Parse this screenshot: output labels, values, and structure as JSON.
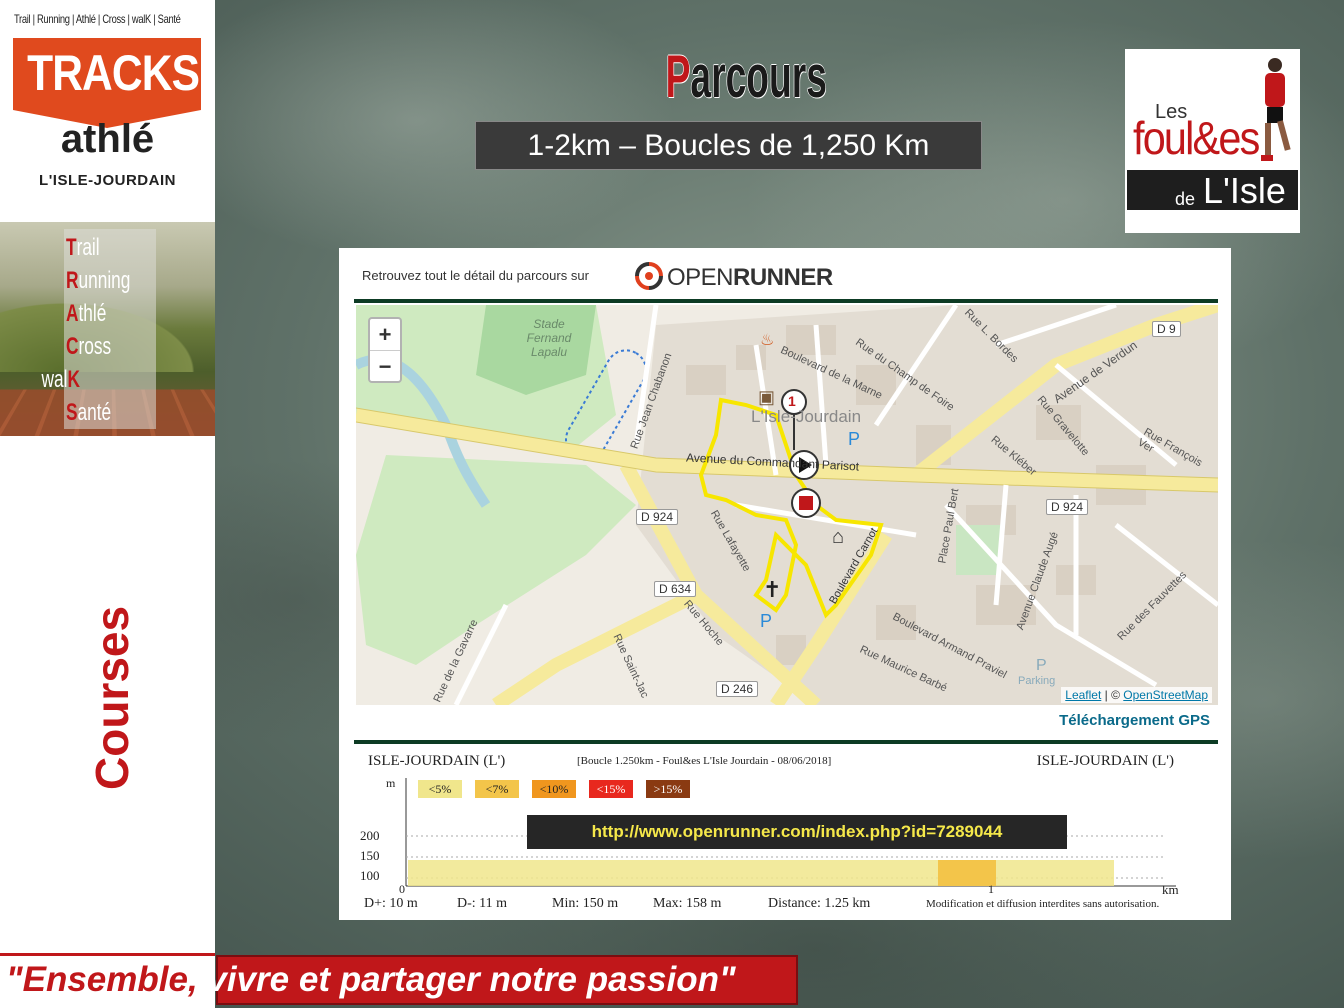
{
  "brand": {
    "tagline": "Trail | Running | Athlé | Cross | walK | Santé",
    "name": "TRACKS",
    "sub": "athlé",
    "city": "L'ISLE-JOURDAIN"
  },
  "acrostic": [
    {
      "initial": "T",
      "rest": "rail"
    },
    {
      "initial": "R",
      "rest": "unning"
    },
    {
      "initial": "A",
      "rest": "thlé"
    },
    {
      "initial": "C",
      "rest": "ross"
    },
    {
      "prefix": "wal",
      "initial": "K",
      "rest": ""
    },
    {
      "initial": "S",
      "rest": "anté"
    }
  ],
  "section_label": "Courses",
  "page": {
    "title_initial": "P",
    "title_rest": "arcours",
    "subtitle": "1-2km – Boucles de 1,250 Km"
  },
  "club_logo": {
    "les": "Les",
    "foul": "foul&es",
    "de": "de",
    "isle": "L'Isle"
  },
  "card": {
    "header_text": "Retrouvez tout le détail du parcours sur",
    "logo_light": "OPEN",
    "logo_bold": "RUNNER"
  },
  "map": {
    "zoom_in": "+",
    "zoom_out": "−",
    "attribution_leaflet": "Leaflet",
    "attribution_sep": "| ©",
    "attribution_osm": "OpenStreetMap",
    "labels": [
      {
        "text": "Stade Fernand Lapalu"
      },
      {
        "text": "L'Isle-Jourdain"
      },
      {
        "text": "Avenue du Commandant Parisot"
      },
      {
        "text": "Boulevard de la Marne"
      },
      {
        "text": "Rue du Champ de Foire"
      },
      {
        "text": "Avenue de Verdun"
      },
      {
        "text": "Rue Jean Chabanon"
      },
      {
        "text": "Rue Gravelotte"
      },
      {
        "text": "Rue Kléber"
      },
      {
        "text": "Rue François Ver"
      },
      {
        "text": "Place Paul Bert"
      },
      {
        "text": "Avenue Claude Augé"
      },
      {
        "text": "Rue des Fauvettes"
      },
      {
        "text": "Boulevard Carnot"
      },
      {
        "text": "Boulevard Armand Praviel"
      },
      {
        "text": "Rue Maurice Barbé"
      },
      {
        "text": "Rue Hoche"
      },
      {
        "text": "Rue Saint-Jac"
      },
      {
        "text": "Rue de la Gavarre"
      },
      {
        "text": "Rue Lafayette"
      },
      {
        "text": "Rue L. Bordes"
      },
      {
        "text": "Parking"
      }
    ],
    "road_badges": [
      "D 9",
      "D 924",
      "D 924",
      "D 634",
      "D 246"
    ],
    "marker_number": "1"
  },
  "gps_link": "Téléchargement GPS",
  "profile": {
    "start": "ISLE-JOURDAIN (L')",
    "title": "[Boucle 1.250km - Foul&es L'Isle Jourdain - 08/06/2018]",
    "end": "ISLE-JOURDAIN (L')",
    "unit_y": "m",
    "legend": [
      {
        "label": "<5%",
        "color": "#f0e68c"
      },
      {
        "label": "<7%",
        "color": "#f3c54a"
      },
      {
        "label": "<10%",
        "color": "#f0961e"
      },
      {
        "label": "<15%",
        "color": "#e8281e"
      },
      {
        "label": ">15%",
        "color": "#8a3a12"
      }
    ],
    "y_ticks": [
      "200",
      "150",
      "100"
    ],
    "x_ticks": [
      "0",
      "1"
    ],
    "unit_x": "km",
    "stats": {
      "d_plus": "D+: 10 m",
      "d_minus": "D-: 11 m",
      "min": "Min: 150 m",
      "max": "Max: 158 m",
      "distance": "Distance: 1.25 km"
    },
    "disclaimer": "Modification et diffusion interdites sans autorisation."
  },
  "url": "http://www.openrunner.com/index.php?id=7289044",
  "motto": {
    "part1": "\"Ensemble,",
    "part2": "vivre et partager notre passion\""
  }
}
